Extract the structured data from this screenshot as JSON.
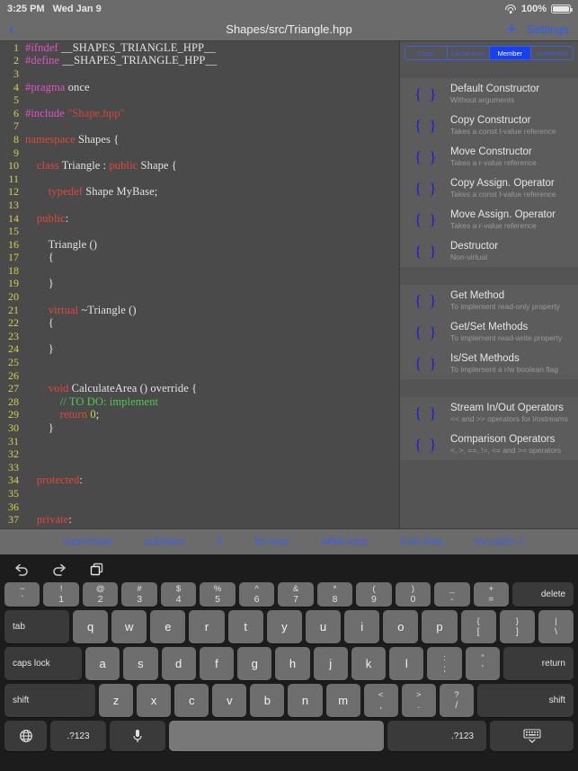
{
  "status_bar": {
    "time": "3:25 PM",
    "date": "Wed Jan 9",
    "battery_percent": "100%",
    "wifi_icon": "wifi-icon",
    "battery_icon": "battery-full-icon"
  },
  "nav_bar": {
    "back_icon": "chevron-left-icon",
    "title": "Shapes/src/Triangle.hpp",
    "add_icon": "plus-icon",
    "settings_label": "Settings"
  },
  "editor": {
    "language": "cpp",
    "lines": [
      {
        "n": "1",
        "tokens": [
          {
            "t": "#ifndef",
            "c": "pre"
          },
          {
            "t": " __SHAPES_TRIANGLE_HPP__",
            "c": "plain"
          }
        ]
      },
      {
        "n": "2",
        "tokens": [
          {
            "t": "#define",
            "c": "pre"
          },
          {
            "t": " __SHAPES_TRIANGLE_HPP__",
            "c": "plain"
          }
        ]
      },
      {
        "n": "3",
        "tokens": []
      },
      {
        "n": "4",
        "tokens": [
          {
            "t": "#pragma",
            "c": "pre"
          },
          {
            "t": " once",
            "c": "plain"
          }
        ]
      },
      {
        "n": "5",
        "tokens": []
      },
      {
        "n": "6",
        "tokens": [
          {
            "t": "#include",
            "c": "pre"
          },
          {
            "t": " ",
            "c": "plain"
          },
          {
            "t": "\"Shape.hpp\"",
            "c": "str"
          }
        ]
      },
      {
        "n": "7",
        "tokens": []
      },
      {
        "n": "8",
        "tokens": [
          {
            "t": "namespace",
            "c": "kw"
          },
          {
            "t": " Shapes {",
            "c": "plain"
          }
        ]
      },
      {
        "n": "9",
        "tokens": []
      },
      {
        "n": "10",
        "tokens": [
          {
            "t": "    ",
            "c": "plain"
          },
          {
            "t": "class",
            "c": "kw"
          },
          {
            "t": " Triangle : ",
            "c": "plain"
          },
          {
            "t": "public",
            "c": "kw"
          },
          {
            "t": " Shape {",
            "c": "plain"
          }
        ]
      },
      {
        "n": "11",
        "tokens": []
      },
      {
        "n": "12",
        "tokens": [
          {
            "t": "        ",
            "c": "plain"
          },
          {
            "t": "typedef",
            "c": "kw"
          },
          {
            "t": " Shape MyBase;",
            "c": "plain"
          }
        ]
      },
      {
        "n": "13",
        "tokens": []
      },
      {
        "n": "14",
        "tokens": [
          {
            "t": "    ",
            "c": "plain"
          },
          {
            "t": "public",
            "c": "kw"
          },
          {
            "t": ":",
            "c": "plain"
          }
        ]
      },
      {
        "n": "15",
        "tokens": []
      },
      {
        "n": "16",
        "tokens": [
          {
            "t": "        Triangle ()",
            "c": "plain"
          }
        ]
      },
      {
        "n": "17",
        "tokens": [
          {
            "t": "        {",
            "c": "plain"
          }
        ]
      },
      {
        "n": "18",
        "tokens": []
      },
      {
        "n": "19",
        "tokens": [
          {
            "t": "        }",
            "c": "plain"
          }
        ]
      },
      {
        "n": "20",
        "tokens": []
      },
      {
        "n": "21",
        "tokens": [
          {
            "t": "        ",
            "c": "plain"
          },
          {
            "t": "virtual",
            "c": "kw"
          },
          {
            "t": " ~Triangle ()",
            "c": "plain"
          }
        ]
      },
      {
        "n": "22",
        "tokens": [
          {
            "t": "        {",
            "c": "plain"
          }
        ]
      },
      {
        "n": "23",
        "tokens": []
      },
      {
        "n": "24",
        "tokens": [
          {
            "t": "        }",
            "c": "plain"
          }
        ]
      },
      {
        "n": "25",
        "tokens": []
      },
      {
        "n": "26",
        "tokens": []
      },
      {
        "n": "27",
        "tokens": [
          {
            "t": "        ",
            "c": "plain"
          },
          {
            "t": "void",
            "c": "kw"
          },
          {
            "t": " CalculateArea () override {",
            "c": "plain"
          }
        ]
      },
      {
        "n": "28",
        "tokens": [
          {
            "t": "            ",
            "c": "plain"
          },
          {
            "t": "// TO DO: implement",
            "c": "cmt"
          }
        ]
      },
      {
        "n": "29",
        "tokens": [
          {
            "t": "            ",
            "c": "plain"
          },
          {
            "t": "return",
            "c": "kw"
          },
          {
            "t": " ",
            "c": "plain"
          },
          {
            "t": "0",
            "c": "num"
          },
          {
            "t": ";",
            "c": "plain"
          }
        ]
      },
      {
        "n": "30",
        "tokens": [
          {
            "t": "        }",
            "c": "plain"
          }
        ]
      },
      {
        "n": "31",
        "tokens": []
      },
      {
        "n": "32",
        "tokens": []
      },
      {
        "n": "33",
        "tokens": []
      },
      {
        "n": "34",
        "tokens": [
          {
            "t": "    ",
            "c": "plain"
          },
          {
            "t": "protected",
            "c": "kw"
          },
          {
            "t": ":",
            "c": "plain"
          }
        ]
      },
      {
        "n": "35",
        "tokens": []
      },
      {
        "n": "36",
        "tokens": []
      },
      {
        "n": "37",
        "tokens": [
          {
            "t": "    ",
            "c": "plain"
          },
          {
            "t": "private",
            "c": "kw"
          },
          {
            "t": ":",
            "c": "plain"
          }
        ]
      }
    ]
  },
  "panel": {
    "segments": [
      {
        "label": "Class",
        "active": false
      },
      {
        "label": "Declaration",
        "active": false
      },
      {
        "label": "Member",
        "active": true
      },
      {
        "label": "Statement",
        "active": false
      }
    ],
    "groups": [
      {
        "items": [
          {
            "icon": "braces-icon",
            "title": "Default Constructor",
            "subtitle": "Without arguments"
          },
          {
            "icon": "braces-icon",
            "title": "Copy Constructor",
            "subtitle": "Takes a const l-value reference"
          },
          {
            "icon": "braces-icon",
            "title": "Move Constructor",
            "subtitle": "Takes a r-value reference"
          },
          {
            "icon": "braces-icon",
            "title": "Copy Assign. Operator",
            "subtitle": "Takes a const l-value reference"
          },
          {
            "icon": "braces-icon",
            "title": "Move Assign. Operator",
            "subtitle": "Takes a r-value reference"
          },
          {
            "icon": "braces-icon",
            "title": "Destructor",
            "subtitle": "Non-virtual"
          }
        ]
      },
      {
        "items": [
          {
            "icon": "braces-icon",
            "title": "Get Method",
            "subtitle": "To implement read-only property"
          },
          {
            "icon": "braces-icon",
            "title": "Get/Set Methods",
            "subtitle": "To implement read-write property"
          },
          {
            "icon": "braces-icon",
            "title": "Is/Set Methods",
            "subtitle": "To implement a r/w boolean flag"
          }
        ]
      },
      {
        "items": [
          {
            "icon": "braces-icon",
            "title": "Stream In/Out Operators",
            "subtitle": "<< and >> operators for i/ostreams"
          },
          {
            "icon": "braces-icon",
            "title": "Comparison Operators",
            "subtitle": "<, >, ==, !=, <= and >= operators"
          }
        ]
      }
    ]
  },
  "shortcut_bar": {
    "items": [
      "superclass",
      "subclass",
      "if",
      "for-loop",
      "while-loop",
      "if-do-loop",
      "try-catch-1"
    ]
  },
  "keyboard": {
    "tools": [
      {
        "icon": "undo-icon"
      },
      {
        "icon": "redo-icon"
      },
      {
        "icon": "paste-icon"
      }
    ],
    "row_numbers": [
      {
        "up": "~",
        "lo": "`"
      },
      {
        "up": "!",
        "lo": "1"
      },
      {
        "up": "@",
        "lo": "2"
      },
      {
        "up": "#",
        "lo": "3"
      },
      {
        "up": "$",
        "lo": "4"
      },
      {
        "up": "%",
        "lo": "5"
      },
      {
        "up": "^",
        "lo": "6"
      },
      {
        "up": "&",
        "lo": "7"
      },
      {
        "up": "*",
        "lo": "8"
      },
      {
        "up": "(",
        "lo": "9"
      },
      {
        "up": ")",
        "lo": "0"
      },
      {
        "up": "_",
        "lo": "-"
      },
      {
        "up": "+",
        "lo": "="
      }
    ],
    "delete_label": "delete",
    "tab_label": "tab",
    "row_q": [
      "q",
      "w",
      "e",
      "r",
      "t",
      "y",
      "u",
      "i",
      "o",
      "p"
    ],
    "row_q_dual": [
      {
        "up": "{",
        "lo": "["
      },
      {
        "up": "}",
        "lo": "]"
      },
      {
        "up": "|",
        "lo": "\\"
      }
    ],
    "caps_label": "caps lock",
    "row_a": [
      "a",
      "s",
      "d",
      "f",
      "g",
      "h",
      "j",
      "k",
      "l"
    ],
    "row_a_dual": [
      {
        "up": ":",
        "lo": ";"
      },
      {
        "up": "”",
        "lo": "’"
      }
    ],
    "return_label": "return",
    "shift_left_label": "shift",
    "row_z": [
      "z",
      "x",
      "c",
      "v",
      "b",
      "n",
      "m"
    ],
    "row_z_dual": [
      {
        "up": "<",
        "lo": ","
      },
      {
        "up": ">",
        "lo": "."
      },
      {
        "up": "?",
        "lo": "/"
      }
    ],
    "shift_right_label": "shift",
    "globe_icon": "globe-icon",
    "num_label_left": ".?123",
    "mic_icon": "microphone-icon",
    "space_label": "",
    "num_label_right": ".?123",
    "dismiss_icon": "keyboard-dismiss-icon"
  }
}
